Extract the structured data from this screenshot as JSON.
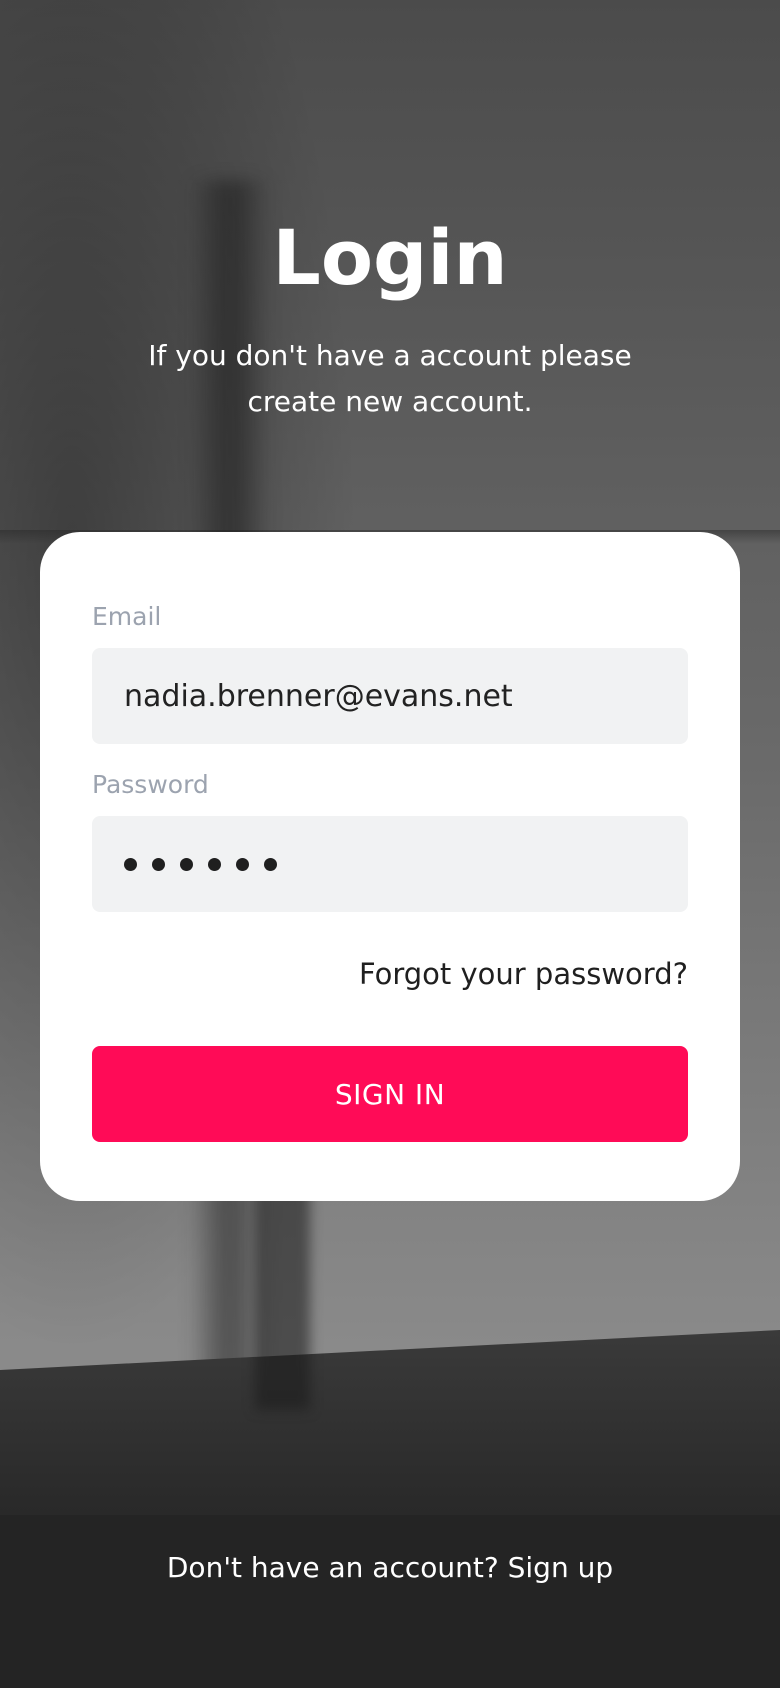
{
  "header": {
    "title": "Login",
    "subtitle": "If you don't have a account please create new account."
  },
  "form": {
    "email_label": "Email",
    "email_value": "nadia.brenner@evans.net",
    "password_label": "Password",
    "password_length": 6,
    "forgot_link": "Forgot your password?",
    "submit_label": "SIGN IN"
  },
  "footer": {
    "prompt": "Don't have an account?",
    "signup_link": "Sign up"
  },
  "colors": {
    "accent": "#ff0b57",
    "card": "#ffffff",
    "input_bg": "#f1f2f3",
    "label": "#9ca3af"
  }
}
